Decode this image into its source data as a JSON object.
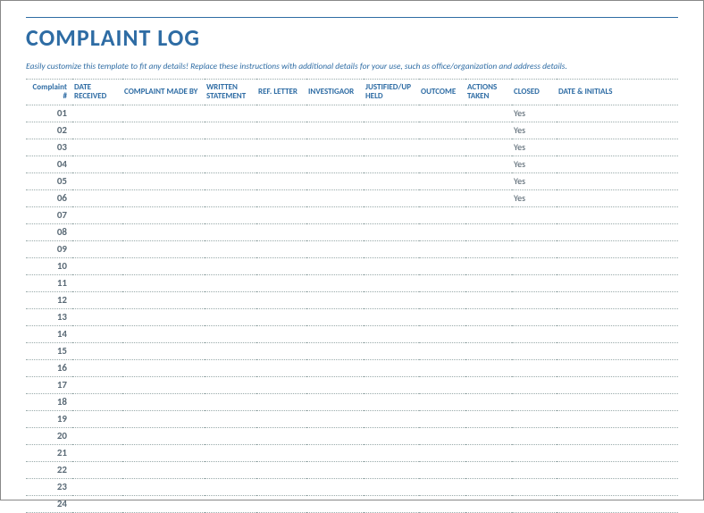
{
  "title": "COMPLAINT LOG",
  "instructions": "Easily customize this template to fit any details! Replace these instructions with additional details for your use, such as office/organization and address details.",
  "columns": {
    "complaint_num": "Complaint #",
    "date_received": "DATE RECEIVED",
    "complaint_made_by": "COMPLAINT MADE BY",
    "written_statement": "WRITTEN STATEMENT",
    "ref_letter": "REF. LETTER",
    "investigator": "INVESTIGAOR",
    "justified_upheld": "JUSTIFIED/UP HELD",
    "outcome": "OUTCOME",
    "actions_taken": "ACTIONS TAKEN",
    "closed": "CLOSED",
    "date_initials": "DATE & INITIALS"
  },
  "rows": [
    {
      "num": "01",
      "date_received": "",
      "made_by": "",
      "statement": "",
      "ref": "",
      "investigator": "",
      "justified": "",
      "outcome": "",
      "actions": "",
      "closed": "Yes",
      "date_initials": ""
    },
    {
      "num": "02",
      "date_received": "",
      "made_by": "",
      "statement": "",
      "ref": "",
      "investigator": "",
      "justified": "",
      "outcome": "",
      "actions": "",
      "closed": "Yes",
      "date_initials": ""
    },
    {
      "num": "03",
      "date_received": "",
      "made_by": "",
      "statement": "",
      "ref": "",
      "investigator": "",
      "justified": "",
      "outcome": "",
      "actions": "",
      "closed": "Yes",
      "date_initials": ""
    },
    {
      "num": "04",
      "date_received": "",
      "made_by": "",
      "statement": "",
      "ref": "",
      "investigator": "",
      "justified": "",
      "outcome": "",
      "actions": "",
      "closed": "Yes",
      "date_initials": ""
    },
    {
      "num": "05",
      "date_received": "",
      "made_by": "",
      "statement": "",
      "ref": "",
      "investigator": "",
      "justified": "",
      "outcome": "",
      "actions": "",
      "closed": "Yes",
      "date_initials": ""
    },
    {
      "num": "06",
      "date_received": "",
      "made_by": "",
      "statement": "",
      "ref": "",
      "investigator": "",
      "justified": "",
      "outcome": "",
      "actions": "",
      "closed": "Yes",
      "date_initials": ""
    },
    {
      "num": "07",
      "date_received": "",
      "made_by": "",
      "statement": "",
      "ref": "",
      "investigator": "",
      "justified": "",
      "outcome": "",
      "actions": "",
      "closed": "",
      "date_initials": ""
    },
    {
      "num": "08",
      "date_received": "",
      "made_by": "",
      "statement": "",
      "ref": "",
      "investigator": "",
      "justified": "",
      "outcome": "",
      "actions": "",
      "closed": "",
      "date_initials": ""
    },
    {
      "num": "09",
      "date_received": "",
      "made_by": "",
      "statement": "",
      "ref": "",
      "investigator": "",
      "justified": "",
      "outcome": "",
      "actions": "",
      "closed": "",
      "date_initials": ""
    },
    {
      "num": "10",
      "date_received": "",
      "made_by": "",
      "statement": "",
      "ref": "",
      "investigator": "",
      "justified": "",
      "outcome": "",
      "actions": "",
      "closed": "",
      "date_initials": ""
    },
    {
      "num": "11",
      "date_received": "",
      "made_by": "",
      "statement": "",
      "ref": "",
      "investigator": "",
      "justified": "",
      "outcome": "",
      "actions": "",
      "closed": "",
      "date_initials": ""
    },
    {
      "num": "12",
      "date_received": "",
      "made_by": "",
      "statement": "",
      "ref": "",
      "investigator": "",
      "justified": "",
      "outcome": "",
      "actions": "",
      "closed": "",
      "date_initials": ""
    },
    {
      "num": "13",
      "date_received": "",
      "made_by": "",
      "statement": "",
      "ref": "",
      "investigator": "",
      "justified": "",
      "outcome": "",
      "actions": "",
      "closed": "",
      "date_initials": ""
    },
    {
      "num": "14",
      "date_received": "",
      "made_by": "",
      "statement": "",
      "ref": "",
      "investigator": "",
      "justified": "",
      "outcome": "",
      "actions": "",
      "closed": "",
      "date_initials": ""
    },
    {
      "num": "15",
      "date_received": "",
      "made_by": "",
      "statement": "",
      "ref": "",
      "investigator": "",
      "justified": "",
      "outcome": "",
      "actions": "",
      "closed": "",
      "date_initials": ""
    },
    {
      "num": "16",
      "date_received": "",
      "made_by": "",
      "statement": "",
      "ref": "",
      "investigator": "",
      "justified": "",
      "outcome": "",
      "actions": "",
      "closed": "",
      "date_initials": ""
    },
    {
      "num": "17",
      "date_received": "",
      "made_by": "",
      "statement": "",
      "ref": "",
      "investigator": "",
      "justified": "",
      "outcome": "",
      "actions": "",
      "closed": "",
      "date_initials": ""
    },
    {
      "num": "18",
      "date_received": "",
      "made_by": "",
      "statement": "",
      "ref": "",
      "investigator": "",
      "justified": "",
      "outcome": "",
      "actions": "",
      "closed": "",
      "date_initials": ""
    },
    {
      "num": "19",
      "date_received": "",
      "made_by": "",
      "statement": "",
      "ref": "",
      "investigator": "",
      "justified": "",
      "outcome": "",
      "actions": "",
      "closed": "",
      "date_initials": ""
    },
    {
      "num": "20",
      "date_received": "",
      "made_by": "",
      "statement": "",
      "ref": "",
      "investigator": "",
      "justified": "",
      "outcome": "",
      "actions": "",
      "closed": "",
      "date_initials": ""
    },
    {
      "num": "21",
      "date_received": "",
      "made_by": "",
      "statement": "",
      "ref": "",
      "investigator": "",
      "justified": "",
      "outcome": "",
      "actions": "",
      "closed": "",
      "date_initials": ""
    },
    {
      "num": "22",
      "date_received": "",
      "made_by": "",
      "statement": "",
      "ref": "",
      "investigator": "",
      "justified": "",
      "outcome": "",
      "actions": "",
      "closed": "",
      "date_initials": ""
    },
    {
      "num": "23",
      "date_received": "",
      "made_by": "",
      "statement": "",
      "ref": "",
      "investigator": "",
      "justified": "",
      "outcome": "",
      "actions": "",
      "closed": "",
      "date_initials": ""
    },
    {
      "num": "24",
      "date_received": "",
      "made_by": "",
      "statement": "",
      "ref": "",
      "investigator": "",
      "justified": "",
      "outcome": "",
      "actions": "",
      "closed": "",
      "date_initials": ""
    }
  ]
}
